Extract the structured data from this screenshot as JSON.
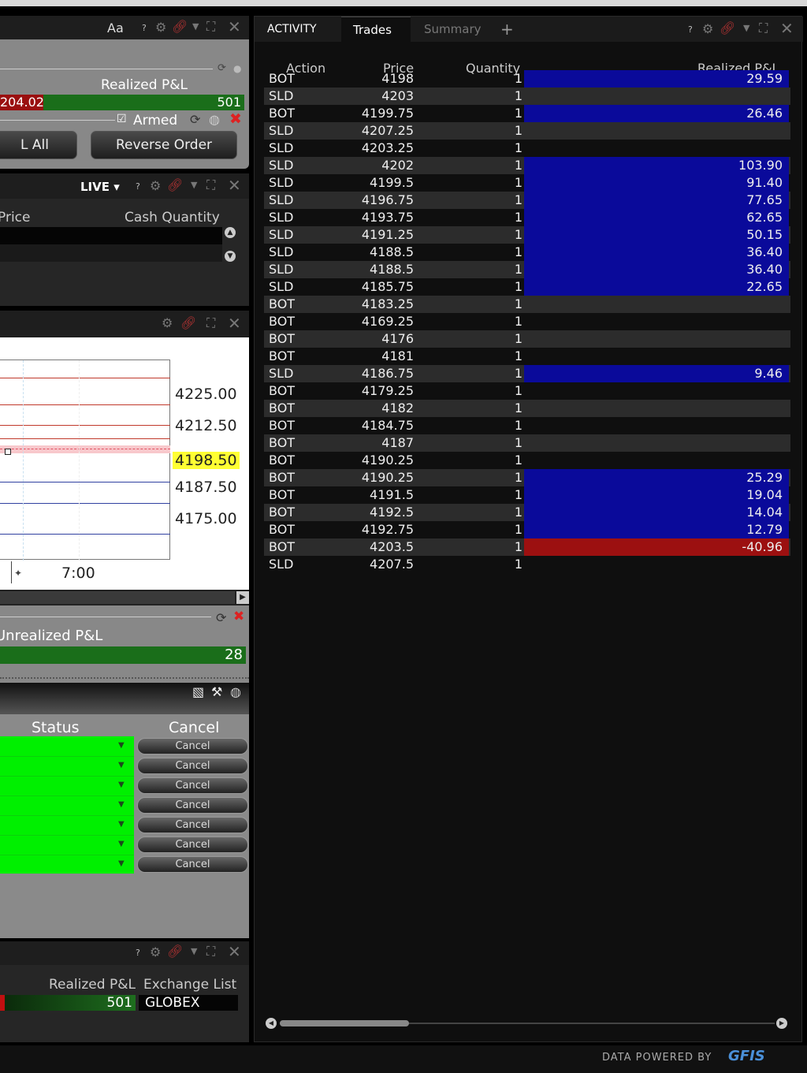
{
  "left": {
    "panel1": {
      "header_font": "Aa",
      "realized_label": "Realized P&L",
      "value_left": "204.02",
      "value_right": "501",
      "armed_label": "Armed",
      "btn_all": "L All",
      "btn_reverse": "Reverse Order"
    },
    "panel2": {
      "mode": "LIVE",
      "col_price": "Price",
      "col_cash_qty": "Cash Quantity"
    },
    "chart": {
      "ticks": [
        "4225.00",
        "4212.50",
        "4198.50",
        "4187.50",
        "4175.00"
      ],
      "time_label": "7:00"
    },
    "panel3": {
      "unrealized_label": "Unrealized P&L",
      "unrealized_value": "28"
    },
    "orders": {
      "col_status": "Status",
      "col_cancel": "Cancel",
      "cancel_label": "Cancel"
    },
    "panel5": {
      "col_realized": "Realized P&L",
      "col_exchange": "Exchange List",
      "realized_value": "501",
      "exchange_value": "GLOBEX"
    }
  },
  "right": {
    "tabs": [
      "ACTIVITY",
      "Trades",
      "Summary",
      "+"
    ],
    "active_tab": "Trades",
    "columns": [
      "Action",
      "Price",
      "Quantity",
      "Realized P&L"
    ],
    "rows": [
      {
        "action": "BOT",
        "price": "4198",
        "qty": "1",
        "pnl": "29.59"
      },
      {
        "action": "SLD",
        "price": "4203",
        "qty": "1",
        "pnl": ""
      },
      {
        "action": "BOT",
        "price": "4199.75",
        "qty": "1",
        "pnl": "26.46"
      },
      {
        "action": "SLD",
        "price": "4207.25",
        "qty": "1",
        "pnl": ""
      },
      {
        "action": "SLD",
        "price": "4203.25",
        "qty": "1",
        "pnl": ""
      },
      {
        "action": "SLD",
        "price": "4202",
        "qty": "1",
        "pnl": "103.90"
      },
      {
        "action": "SLD",
        "price": "4199.5",
        "qty": "1",
        "pnl": "91.40"
      },
      {
        "action": "SLD",
        "price": "4196.75",
        "qty": "1",
        "pnl": "77.65"
      },
      {
        "action": "SLD",
        "price": "4193.75",
        "qty": "1",
        "pnl": "62.65"
      },
      {
        "action": "SLD",
        "price": "4191.25",
        "qty": "1",
        "pnl": "50.15"
      },
      {
        "action": "SLD",
        "price": "4188.5",
        "qty": "1",
        "pnl": "36.40"
      },
      {
        "action": "SLD",
        "price": "4188.5",
        "qty": "1",
        "pnl": "36.40"
      },
      {
        "action": "SLD",
        "price": "4185.75",
        "qty": "1",
        "pnl": "22.65"
      },
      {
        "action": "BOT",
        "price": "4183.25",
        "qty": "1",
        "pnl": ""
      },
      {
        "action": "BOT",
        "price": "4169.25",
        "qty": "1",
        "pnl": ""
      },
      {
        "action": "BOT",
        "price": "4176",
        "qty": "1",
        "pnl": ""
      },
      {
        "action": "BOT",
        "price": "4181",
        "qty": "1",
        "pnl": ""
      },
      {
        "action": "SLD",
        "price": "4186.75",
        "qty": "1",
        "pnl": "9.46"
      },
      {
        "action": "BOT",
        "price": "4179.25",
        "qty": "1",
        "pnl": ""
      },
      {
        "action": "BOT",
        "price": "4182",
        "qty": "1",
        "pnl": ""
      },
      {
        "action": "BOT",
        "price": "4184.75",
        "qty": "1",
        "pnl": ""
      },
      {
        "action": "BOT",
        "price": "4187",
        "qty": "1",
        "pnl": ""
      },
      {
        "action": "BOT",
        "price": "4190.25",
        "qty": "1",
        "pnl": ""
      },
      {
        "action": "BOT",
        "price": "4190.25",
        "qty": "1",
        "pnl": "25.29"
      },
      {
        "action": "BOT",
        "price": "4191.5",
        "qty": "1",
        "pnl": "19.04"
      },
      {
        "action": "BOT",
        "price": "4192.5",
        "qty": "1",
        "pnl": "14.04"
      },
      {
        "action": "BOT",
        "price": "4192.75",
        "qty": "1",
        "pnl": "12.79"
      },
      {
        "action": "BOT",
        "price": "4203.5",
        "qty": "1",
        "pnl": "-40.96"
      },
      {
        "action": "SLD",
        "price": "4207.5",
        "qty": "1",
        "pnl": ""
      }
    ]
  },
  "footer": {
    "powered": "DATA POWERED BY",
    "brand": "GFIS"
  },
  "colors": {
    "positive": "#0a0a9a",
    "negative": "#9c1010",
    "status_green": "#00f000",
    "highlight": "#ffff33"
  }
}
